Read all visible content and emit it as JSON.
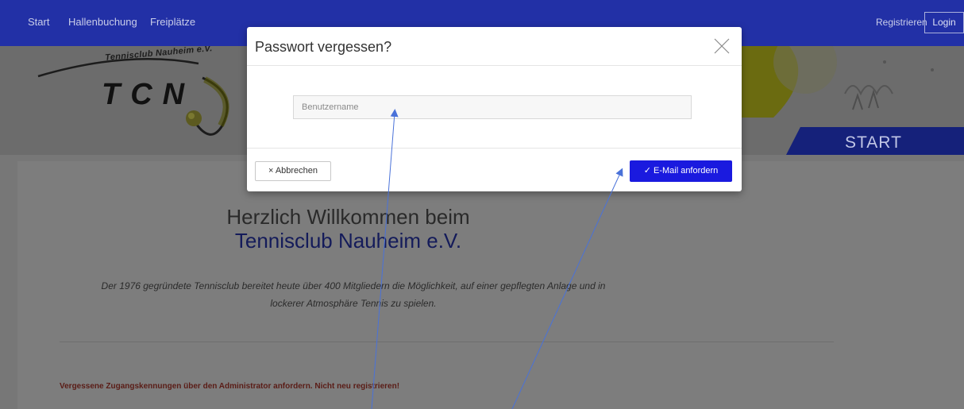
{
  "nav": {
    "start": "Start",
    "hallenbuchung": "Hallenbuchung",
    "freiplaetze": "Freiplätze",
    "registrieren": "Registrieren",
    "login": "Login"
  },
  "header": {
    "logo_top": "Tennisclub Nauheim e.V.",
    "logo_big": "TCN",
    "banner": "START"
  },
  "main": {
    "welcome": "Herzlich Willkommen beim",
    "club_name": "Tennisclub Nauheim e.V.",
    "description": "Der 1976 gegründete Tennisclub bereitet heute über 400 Mitgliedern die Möglichkeit, auf einer gepflegten Anlage und in lockerer Atmosphäre Tennis zu spielen.",
    "warning": "Vergessene Zugangskennungen über den Administrator anfordern. Nicht neu registrieren!"
  },
  "modal": {
    "title": "Passwort vergessen?",
    "username_placeholder": "Benutzername",
    "cancel_label": "× Abbrechen",
    "submit_label": "✓ E-Mail anfordern"
  },
  "colors": {
    "nav_bg": "#2230a6",
    "accent_blue": "#1a1adf",
    "arrow": "#4a72d9"
  }
}
